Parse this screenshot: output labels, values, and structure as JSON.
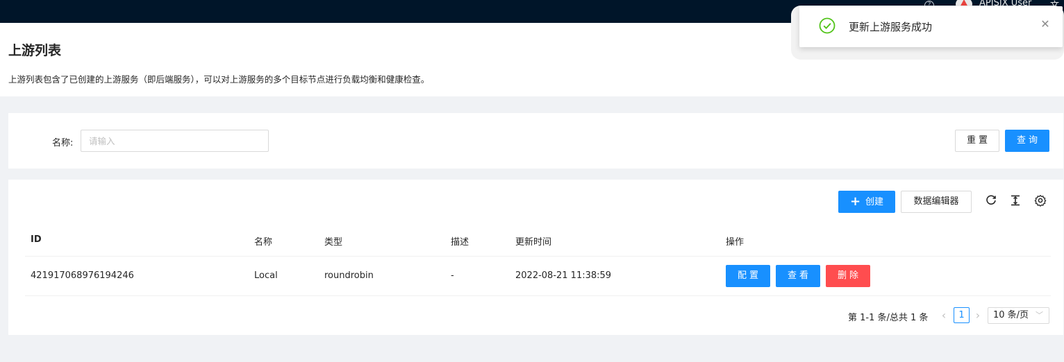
{
  "topbar": {
    "help_icon": "question-circle-icon",
    "user_name": "APISIX User",
    "lang_label": "文"
  },
  "header": {
    "title": "上游列表",
    "description": "上游列表包含了已创建的上游服务（即后端服务），可以对上游服务的多个目标节点进行负载均衡和健康检查。"
  },
  "search": {
    "name_label": "名称:",
    "name_placeholder": "请输入",
    "reset_label": "重置",
    "query_label": "查询"
  },
  "toolbar": {
    "create_label": "创建",
    "editor_label": "数据编辑器",
    "icons": [
      "reload-icon",
      "column-height-icon",
      "setting-icon"
    ]
  },
  "table": {
    "columns": [
      "ID",
      "名称",
      "类型",
      "描述",
      "更新时间",
      "操作"
    ],
    "rows": [
      {
        "id": "421917068976194246",
        "name": "Local",
        "type": "roundrobin",
        "desc": "-",
        "updated": "2022-08-21 11:38:59",
        "actions": [
          "配置",
          "查看",
          "删除"
        ]
      }
    ]
  },
  "pagination": {
    "total_text": "第 1-1 条/总共 1 条",
    "prev": "‹",
    "current_page": "1",
    "next": "›",
    "page_size": "10 条/页"
  },
  "toast": {
    "message": "更新上游服务成功",
    "close": "✕"
  },
  "colors": {
    "topbar": "#001529",
    "primary": "#1890ff",
    "danger": "#ff4d4f",
    "success": "#52c41a"
  }
}
